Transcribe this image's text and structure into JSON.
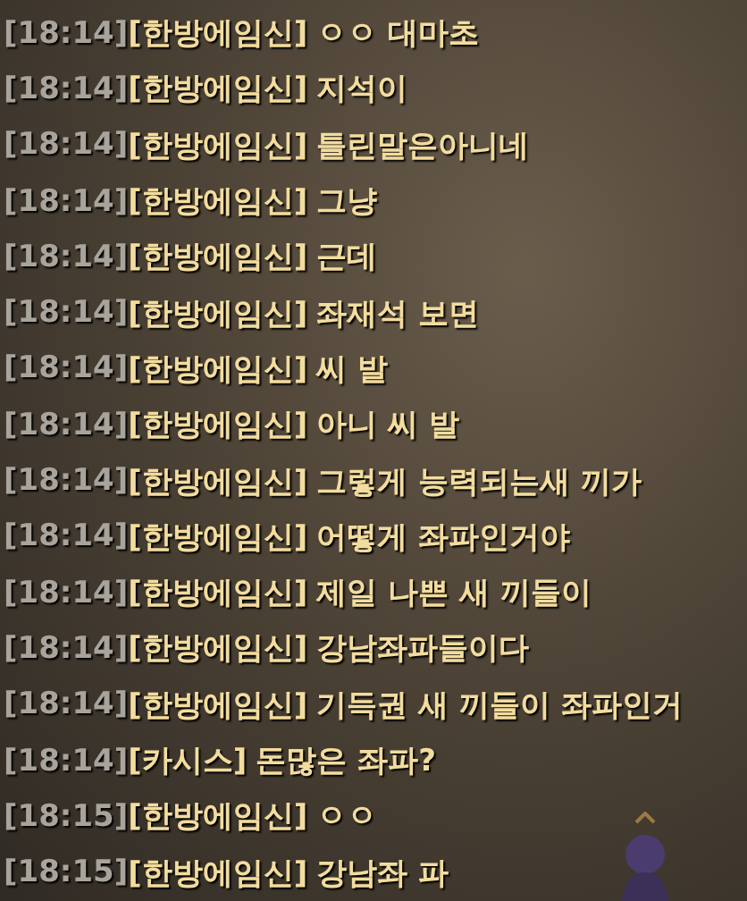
{
  "chat": [
    {
      "time": "[18:14]",
      "sender": "[한방에임신]",
      "message": "ㅇㅇ 대마초"
    },
    {
      "time": "[18:14]",
      "sender": "[한방에임신]",
      "message": "지석이"
    },
    {
      "time": "[18:14]",
      "sender": "[한방에임신]",
      "message": "틀린말은아니네"
    },
    {
      "time": "[18:14]",
      "sender": "[한방에임신]",
      "message": "그냥"
    },
    {
      "time": "[18:14]",
      "sender": "[한방에임신]",
      "message": "근데"
    },
    {
      "time": "[18:14]",
      "sender": "[한방에임신]",
      "message": "좌재석 보면"
    },
    {
      "time": "[18:14]",
      "sender": "[한방에임신]",
      "message": "씨 발"
    },
    {
      "time": "[18:14]",
      "sender": "[한방에임신]",
      "message": "아니 씨 발"
    },
    {
      "time": "[18:14]",
      "sender": "[한방에임신]",
      "message": "그렇게 능력되는새 끼가"
    },
    {
      "time": "[18:14]",
      "sender": "[한방에임신]",
      "message": "어떻게 좌파인거야"
    },
    {
      "time": "[18:14]",
      "sender": "[한방에임신]",
      "message": "제일 나쁜 새 끼들이"
    },
    {
      "time": "[18:14]",
      "sender": "[한방에임신]",
      "message": "강남좌파들이다"
    },
    {
      "time": "[18:14]",
      "sender": "[한방에임신]",
      "message": "기득권 새 끼들이 좌파인거"
    },
    {
      "time": "[18:14]",
      "sender": "[카시스]",
      "message": "돈많은 좌파?"
    },
    {
      "time": "[18:15]",
      "sender": "[한방에임신]",
      "message": "ㅇㅇ"
    },
    {
      "time": "[18:15]",
      "sender": "[한방에임신]",
      "message": "강남좌 파"
    }
  ]
}
